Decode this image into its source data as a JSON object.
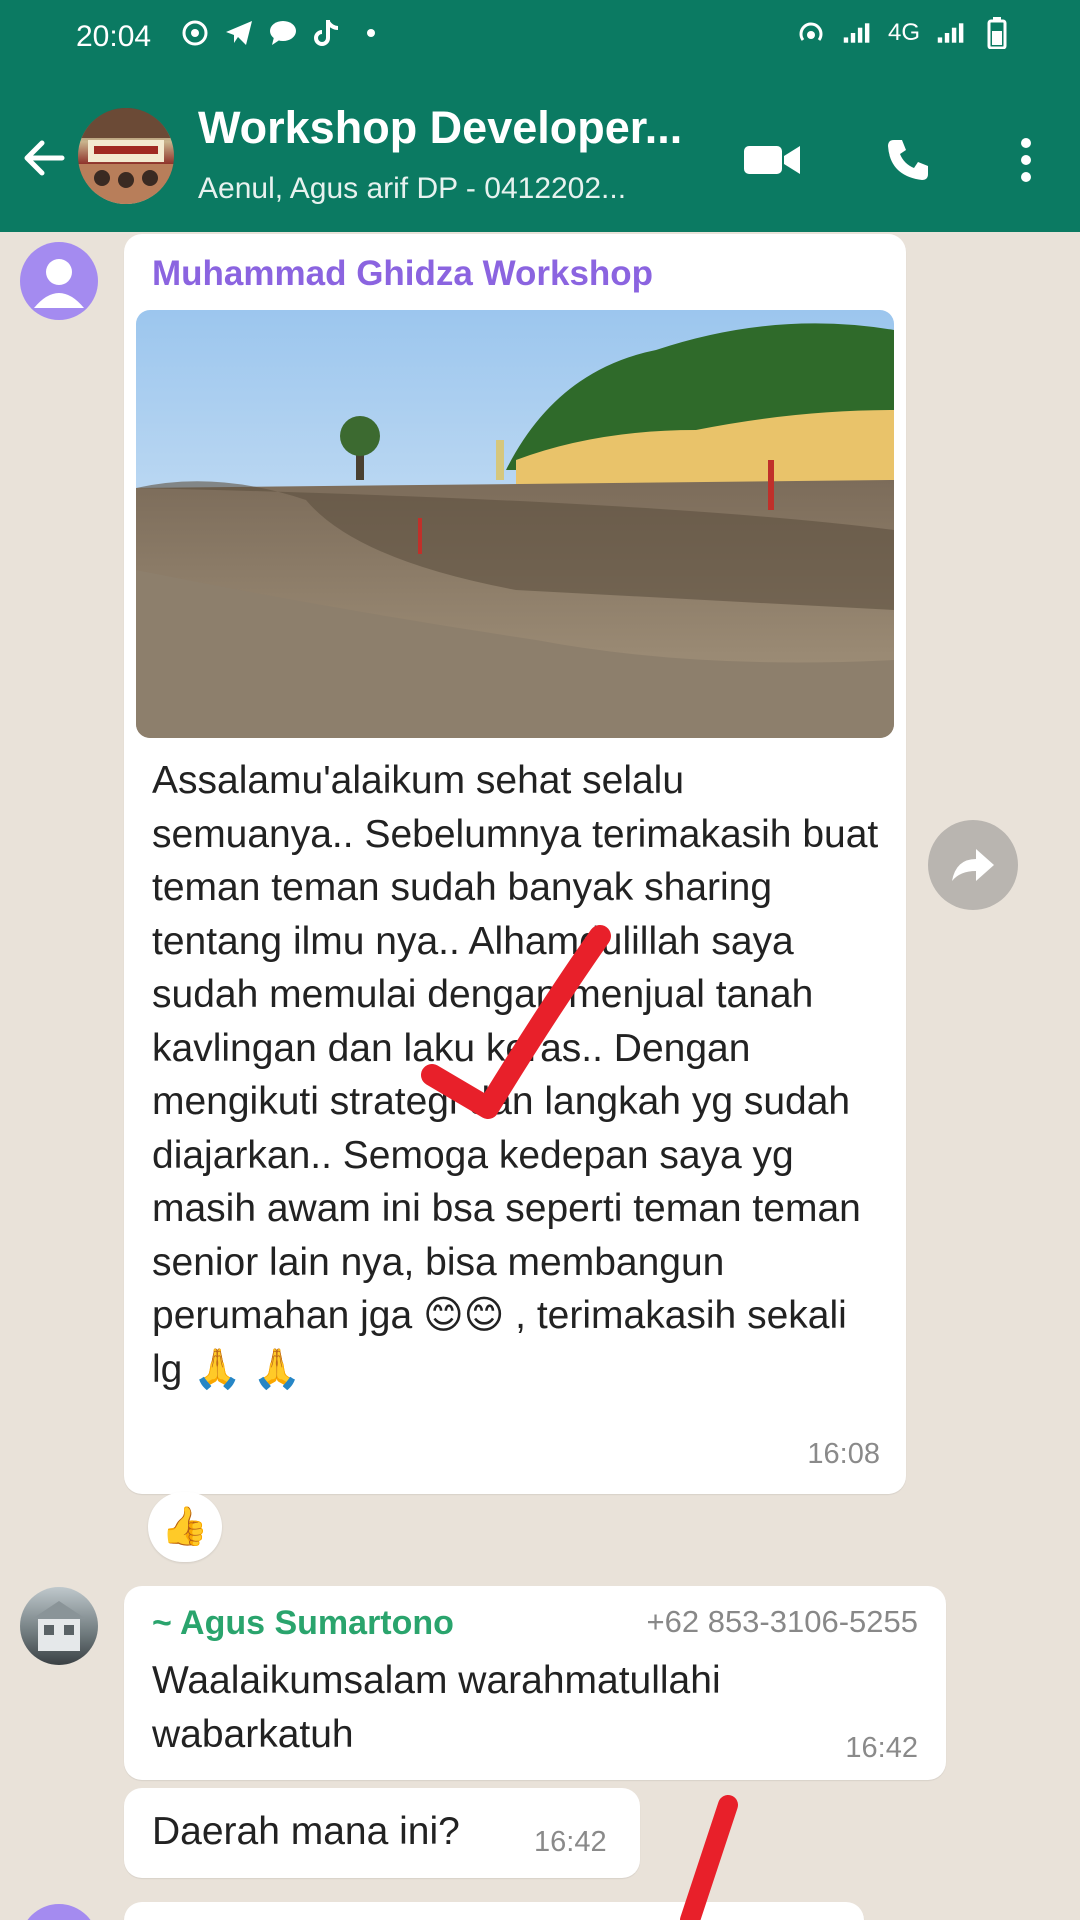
{
  "status_bar": {
    "time": "20:04",
    "network": "4G"
  },
  "header": {
    "title": "Workshop Developer...",
    "subtitle": "Aenul, Agus arif DP - 0412202..."
  },
  "messages": [
    {
      "sender": "Muhammad Ghidza Workshop",
      "text": "Assalamu'alaikum sehat selalu semuanya.. Sebelumnya terimakasih buat teman teman sudah banyak sharing tentang ilmu nya.. Alhamdulillah saya sudah memulai dengan menjual tanah kavlingan dan laku keras.. Dengan mengikuti strategi dan langkah yg sudah diajarkan.. Semoga kedepan saya yg masih awam ini bsa seperti teman teman senior lain nya, bisa membangun perumahan jga 😊😊 , terimakasih sekali lg 🙏 🙏",
      "time": "16:08",
      "reaction": "👍"
    },
    {
      "sender": "~ Agus Sumartono",
      "phone": "+62 853-3106-5255",
      "text": "Waalaikumsalam warahmatullahi wabarkatuh",
      "time": "16:42"
    },
    {
      "text": "Daerah mana ini?",
      "time": "16:42"
    }
  ],
  "colors": {
    "header_bg": "#0b7a62",
    "chat_bg": "#e9e2d9",
    "sender1": "#8b64e0",
    "sender2": "#2aa46d",
    "annotation": "#e8202a"
  }
}
